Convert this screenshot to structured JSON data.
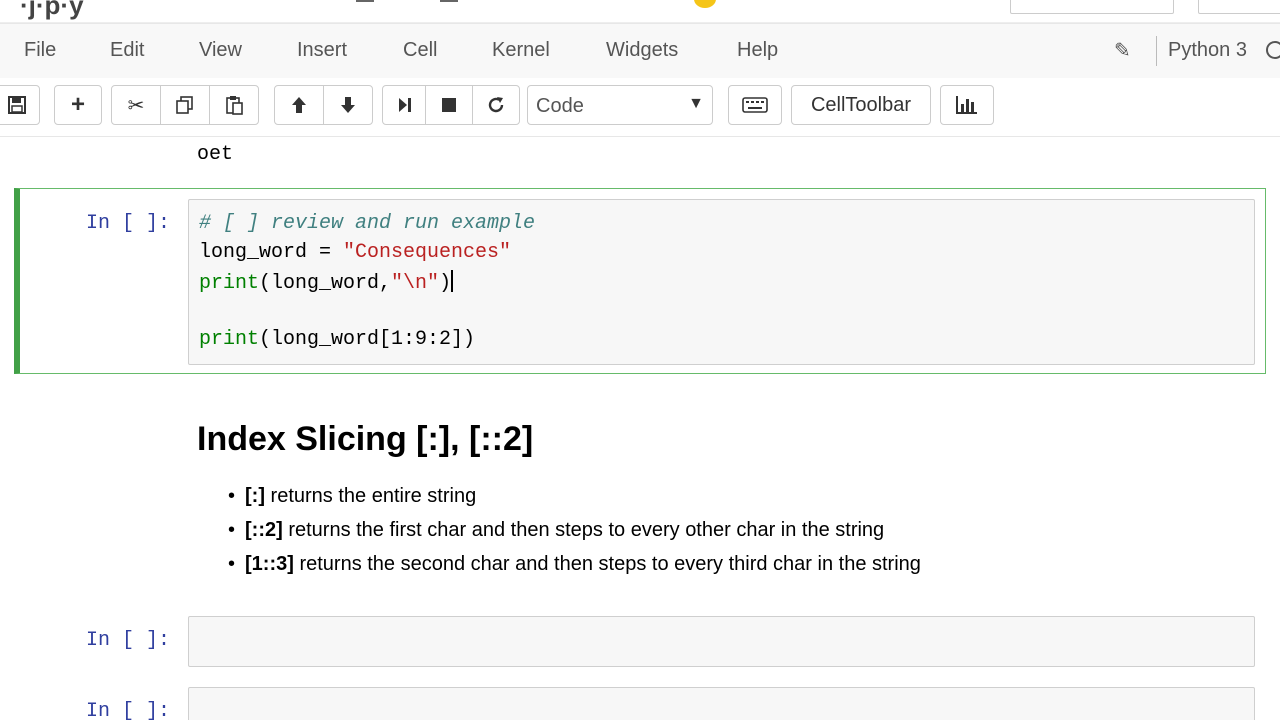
{
  "menu": {
    "items": [
      "File",
      "Edit",
      "View",
      "Insert",
      "Cell",
      "Kernel",
      "Widgets",
      "Help"
    ],
    "kernel": "Python 3"
  },
  "toolbar": {
    "cell_type": "Code",
    "celltoolbar_label": "CellToolbar"
  },
  "notebook": {
    "prev_output": "oet",
    "cells": [
      {
        "prompt": "In [ ]:",
        "lines": [
          "# [ ] review and run example",
          "long_word = \"Consequences\"",
          "print(long_word,\"\\n\")",
          "",
          "print(long_word[1:9:2])"
        ]
      }
    ],
    "markdown": {
      "title": "Index Slicing [:], [::2]",
      "bullets": [
        {
          "code": "[:]",
          "text": " returns the entire string"
        },
        {
          "code": "[::2]",
          "text": " returns the first char and then steps to every other char in the string"
        },
        {
          "code": "[1::3]",
          "text": " returns the second char and then steps to every third char in the string"
        }
      ]
    },
    "empty_prompts": [
      "In [ ]:",
      "In [ ]:"
    ]
  }
}
